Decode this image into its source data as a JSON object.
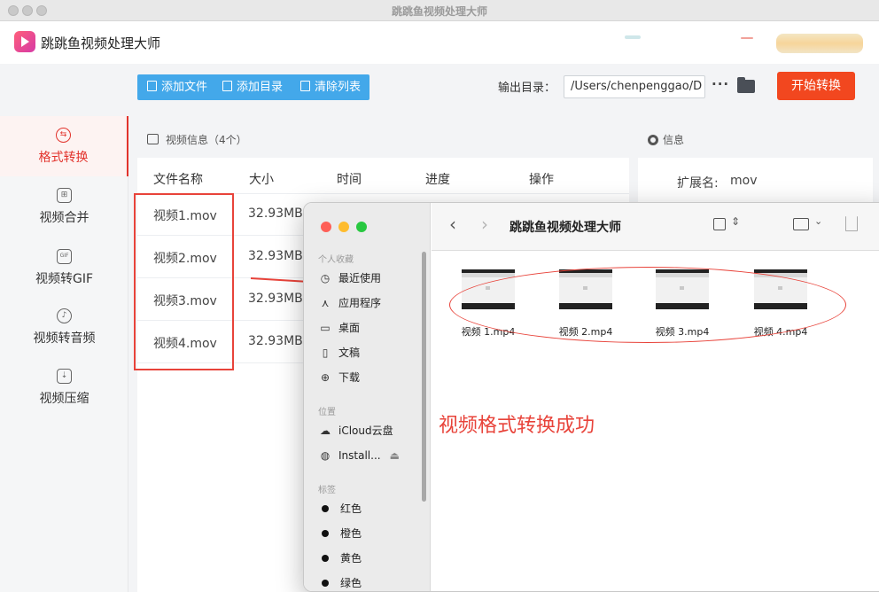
{
  "window": {
    "title": "跳跳鱼视频处理大师"
  },
  "header": {
    "app_title": "跳跳鱼视频处理大师"
  },
  "toolbar": {
    "add_file": "添加文件",
    "add_dir": "添加目录",
    "clear_list": "清除列表",
    "output_label": "输出目录：",
    "output_path": "/Users/chenpenggao/D",
    "more": "···",
    "start": "开始转换"
  },
  "sidebar": {
    "items": [
      {
        "label": "格式转换",
        "icon": "convert-icon"
      },
      {
        "label": "视频合并",
        "icon": "merge-icon"
      },
      {
        "label": "视频转GIF",
        "icon": "gif-icon",
        "icon_text": "GIF"
      },
      {
        "label": "视频转音频",
        "icon": "audio-icon"
      },
      {
        "label": "视频压缩",
        "icon": "compress-icon"
      }
    ]
  },
  "video_panel": {
    "header": "视频信息（4个）",
    "columns": [
      "文件名称",
      "大小",
      "时间",
      "进度",
      "操作"
    ],
    "rows": [
      {
        "name": "视频1.mov",
        "size": "32.93MB"
      },
      {
        "name": "视频2.mov",
        "size": "32.93MB"
      },
      {
        "name": "视频3.mov",
        "size": "32.93MB"
      },
      {
        "name": "视频4.mov",
        "size": "32.93MB"
      }
    ]
  },
  "info_panel": {
    "header": "信息",
    "ext_label": "扩展名:",
    "ext_value": "mov"
  },
  "finder": {
    "title": "跳跳鱼视频处理大师",
    "favorites_label": "个人收藏",
    "favorites": [
      {
        "label": "最近使用",
        "icon": "clock-icon"
      },
      {
        "label": "应用程序",
        "icon": "apps-icon"
      },
      {
        "label": "桌面",
        "icon": "desktop-icon"
      },
      {
        "label": "文稿",
        "icon": "document-icon"
      },
      {
        "label": "下载",
        "icon": "download-icon"
      }
    ],
    "locations_label": "位置",
    "locations": [
      {
        "label": "iCloud云盘",
        "icon": "cloud-icon"
      },
      {
        "label": "Install...",
        "icon": "disk-icon"
      }
    ],
    "tags_label": "标签",
    "tags": [
      {
        "label": "红色",
        "color": "#111111"
      },
      {
        "label": "橙色",
        "color": "#111111"
      },
      {
        "label": "黄色",
        "color": "#111111"
      },
      {
        "label": "绿色",
        "color": "#111111"
      }
    ],
    "files": [
      "视频 1.mp4",
      "视频 2.mp4",
      "视频 3.mp4",
      "视频 4.mp4"
    ]
  },
  "annotation": {
    "success_text": "视频格式转换成功"
  },
  "colors": {
    "accent_red": "#e2332c",
    "toolbar_blue": "#43a8ea",
    "start_button": "#f2471f"
  }
}
